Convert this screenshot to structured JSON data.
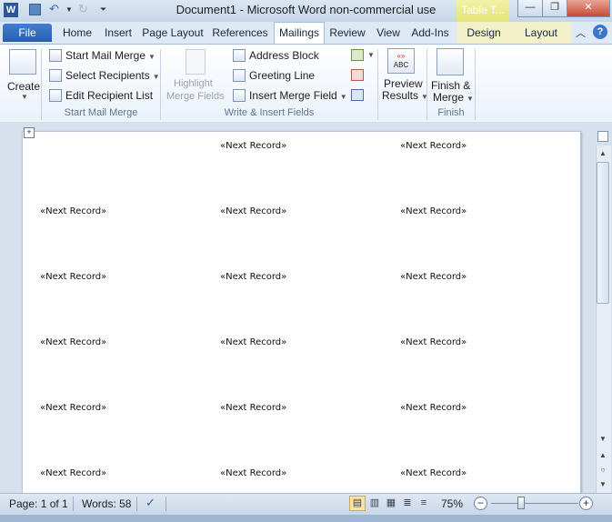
{
  "window": {
    "title": "Document1  -  Microsoft Word non-commercial use",
    "contextual_tab": "Table T..."
  },
  "tabs": [
    "File",
    "Home",
    "Insert",
    "Page Layout",
    "References",
    "Mailings",
    "Review",
    "View",
    "Add-Ins",
    "Design",
    "Layout"
  ],
  "active_tab": "Mailings",
  "ribbon": {
    "create": "Create",
    "start_mail_merge": "Start Mail Merge",
    "select_recipients": "Select Recipients",
    "edit_recipient_list": "Edit Recipient List",
    "group_start": "Start Mail Merge",
    "highlight_1": "Highlight",
    "highlight_2": "Merge Fields",
    "address_block": "Address Block",
    "greeting_line": "Greeting Line",
    "insert_merge_field": "Insert Merge Field",
    "group_write": "Write & Insert Fields",
    "preview_1": "Preview",
    "preview_2": "Results",
    "preview_icon_text": "ABC",
    "finish_1": "Finish &",
    "finish_2": "Merge",
    "group_preview": "Preview Results",
    "group_finish": "Finish"
  },
  "document": {
    "record_text": "«Next Record»"
  },
  "status": {
    "page": "Page: 1 of 1",
    "words": "Words: 58",
    "zoom": "75%"
  },
  "colors": {
    "file_tab": "#2a5fae",
    "contextual": "#e6e37a",
    "ribbon_bg": "#ffffff",
    "status_bg": "#c8d6e8"
  }
}
